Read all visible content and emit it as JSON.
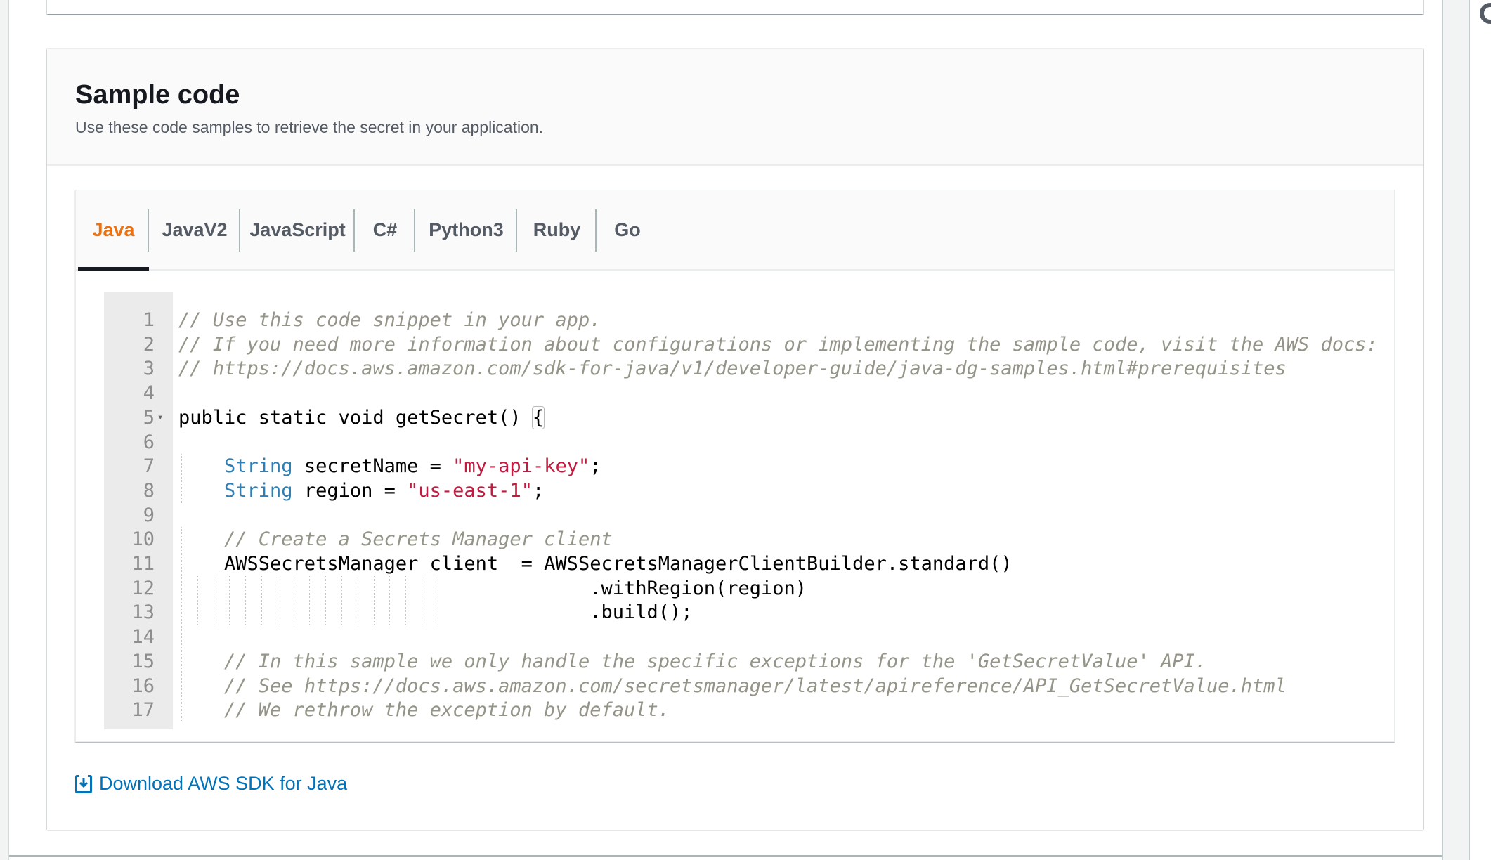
{
  "panel": {
    "title": "Sample code",
    "description": "Use these code samples to retrieve the secret in your application."
  },
  "tabs": [
    {
      "label": "Java",
      "active": true
    },
    {
      "label": "JavaV2",
      "active": false
    },
    {
      "label": "JavaScript",
      "active": false
    },
    {
      "label": "C#",
      "active": false
    },
    {
      "label": "Python3",
      "active": false
    },
    {
      "label": "Ruby",
      "active": false
    },
    {
      "label": "Go",
      "active": false
    }
  ],
  "colors": {
    "active_tab": "#ec7211",
    "link": "#0073bb",
    "comment": "#949488",
    "type": "#2f7fb4",
    "string": "#c41a3f"
  },
  "code": {
    "language": "Java",
    "lines": [
      {
        "n": "1",
        "segments": [
          {
            "t": "// Use this code snippet in your app.",
            "c": "comment"
          }
        ]
      },
      {
        "n": "2",
        "segments": [
          {
            "t": "// If you need more information about configurations or implementing the sample code, visit the AWS docs:",
            "c": "comment"
          }
        ]
      },
      {
        "n": "3",
        "segments": [
          {
            "t": "// https://docs.aws.amazon.com/sdk-for-java/v1/developer-guide/java-dg-samples.html#prerequisites",
            "c": "comment"
          }
        ]
      },
      {
        "n": "4",
        "segments": []
      },
      {
        "n": "5",
        "fold": true,
        "segments": [
          {
            "t": "public static void getSecret() ",
            "c": "plain"
          },
          {
            "t": "{",
            "c": "bracket"
          }
        ]
      },
      {
        "n": "6",
        "segments": []
      },
      {
        "n": "7",
        "segments": [
          {
            "t": "    ",
            "c": "plain"
          },
          {
            "t": "String",
            "c": "type"
          },
          {
            "t": " secretName = ",
            "c": "plain"
          },
          {
            "t": "\"my-api-key\"",
            "c": "str"
          },
          {
            "t": ";",
            "c": "plain"
          }
        ]
      },
      {
        "n": "8",
        "segments": [
          {
            "t": "    ",
            "c": "plain"
          },
          {
            "t": "String",
            "c": "type"
          },
          {
            "t": " region = ",
            "c": "plain"
          },
          {
            "t": "\"us-east-1\"",
            "c": "str"
          },
          {
            "t": ";",
            "c": "plain"
          }
        ]
      },
      {
        "n": "9",
        "segments": []
      },
      {
        "n": "10",
        "segments": [
          {
            "t": "    ",
            "c": "plain"
          },
          {
            "t": "// Create a Secrets Manager client",
            "c": "comment"
          }
        ]
      },
      {
        "n": "11",
        "segments": [
          {
            "t": "    AWSSecretsManager client  = AWSSecretsManagerClientBuilder.standard()",
            "c": "plain"
          }
        ]
      },
      {
        "n": "12",
        "segments": [
          {
            "t": "                                    .withRegion(region)",
            "c": "plain"
          }
        ]
      },
      {
        "n": "13",
        "segments": [
          {
            "t": "                                    .build();",
            "c": "plain"
          }
        ]
      },
      {
        "n": "14",
        "segments": []
      },
      {
        "n": "15",
        "segments": [
          {
            "t": "    ",
            "c": "plain"
          },
          {
            "t": "// In this sample we only handle the specific exceptions for the 'GetSecretValue' API.",
            "c": "comment"
          }
        ]
      },
      {
        "n": "16",
        "segments": [
          {
            "t": "    ",
            "c": "plain"
          },
          {
            "t": "// See https://docs.aws.amazon.com/secretsmanager/latest/apireference/API_GetSecretValue.html",
            "c": "comment"
          }
        ]
      },
      {
        "n": "17",
        "segments": [
          {
            "t": "    ",
            "c": "plain"
          },
          {
            "t": "// We rethrow the exception by default.",
            "c": "comment"
          }
        ]
      }
    ]
  },
  "download": {
    "label": "Download AWS SDK for Java",
    "icon": "download-icon"
  }
}
